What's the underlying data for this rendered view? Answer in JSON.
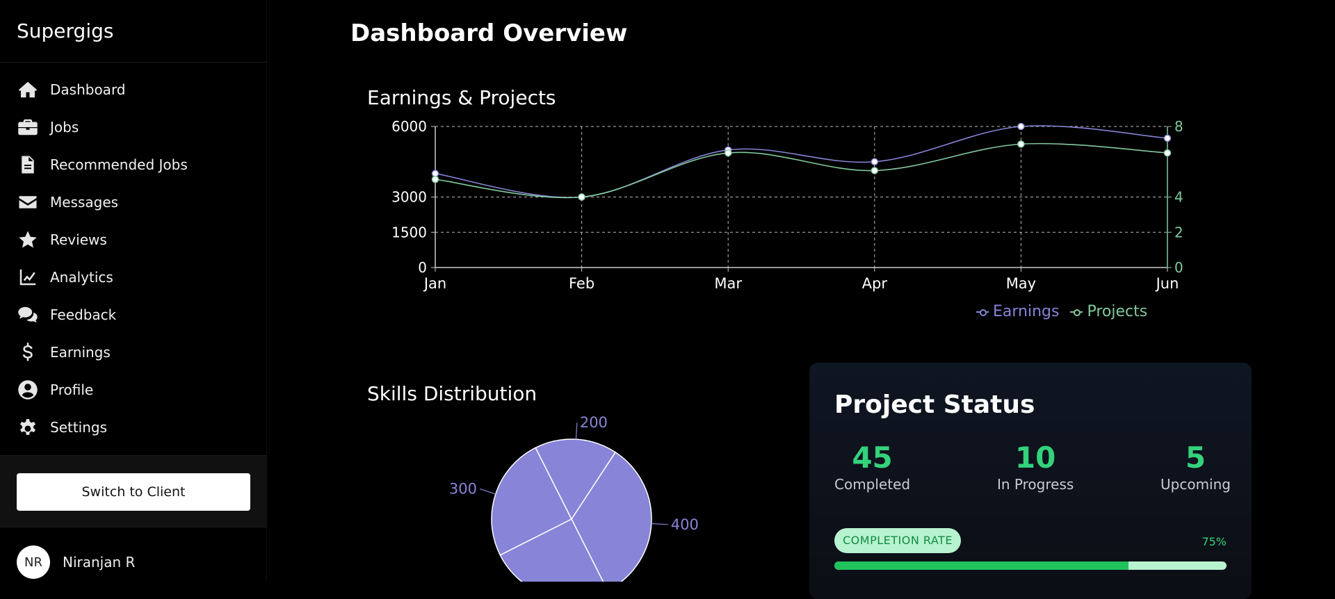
{
  "app": {
    "name": "Supergigs"
  },
  "sidebar": {
    "items": [
      {
        "label": "Dashboard",
        "icon": "home-icon"
      },
      {
        "label": "Jobs",
        "icon": "briefcase-icon"
      },
      {
        "label": "Recommended Jobs",
        "icon": "document-icon"
      },
      {
        "label": "Messages",
        "icon": "envelope-icon"
      },
      {
        "label": "Reviews",
        "icon": "star-icon"
      },
      {
        "label": "Analytics",
        "icon": "line-chart-icon"
      },
      {
        "label": "Feedback",
        "icon": "comments-icon"
      },
      {
        "label": "Earnings",
        "icon": "dollar-icon"
      },
      {
        "label": "Profile",
        "icon": "user-circle-icon"
      },
      {
        "label": "Settings",
        "icon": "gear-icon"
      }
    ],
    "switch_label": "Switch to Client",
    "user": {
      "initials": "NR",
      "name": "Niranjan R"
    }
  },
  "main": {
    "title": "Dashboard Overview",
    "earnings_section": "Earnings & Projects",
    "skills_section": "Skills Distribution"
  },
  "chart_data": [
    {
      "type": "line",
      "title": "Earnings & Projects",
      "categories": [
        "Jan",
        "Feb",
        "Mar",
        "Apr",
        "May",
        "Jun"
      ],
      "y_left": {
        "ticks": [
          0,
          1500,
          3000,
          6000
        ],
        "range": [
          0,
          6000
        ]
      },
      "y_right": {
        "ticks": [
          0,
          2,
          4,
          8
        ],
        "range": [
          0,
          8
        ]
      },
      "grid": true,
      "legend_position": "bottom",
      "series": [
        {
          "name": "Earnings",
          "axis": "left",
          "color": "#8884d8",
          "values": [
            4000,
            3000,
            5000,
            4500,
            6000,
            5500
          ]
        },
        {
          "name": "Projects",
          "axis": "right",
          "color": "#82ca9d",
          "values": [
            5,
            4,
            6.5,
            5.5,
            7,
            6.5
          ]
        }
      ]
    },
    {
      "type": "pie",
      "title": "Skills Distribution",
      "color": "#8884d8",
      "slices": [
        {
          "value": 400
        },
        {
          "value": 300
        },
        {
          "value": 300
        },
        {
          "value": 200
        }
      ],
      "visible_labels": [
        "400",
        "300",
        "200"
      ]
    }
  ],
  "project_status": {
    "title": "Project Status",
    "stats": [
      {
        "value": "45",
        "label": "Completed"
      },
      {
        "value": "10",
        "label": "In Progress"
      },
      {
        "value": "5",
        "label": "Upcoming"
      }
    ],
    "completion_label": "COMPLETION RATE",
    "completion_text": "75%",
    "completion_value": 0.75
  },
  "colors": {
    "accent_green": "#34d27b",
    "earnings": "#8884d8",
    "projects": "#82ca9d"
  }
}
